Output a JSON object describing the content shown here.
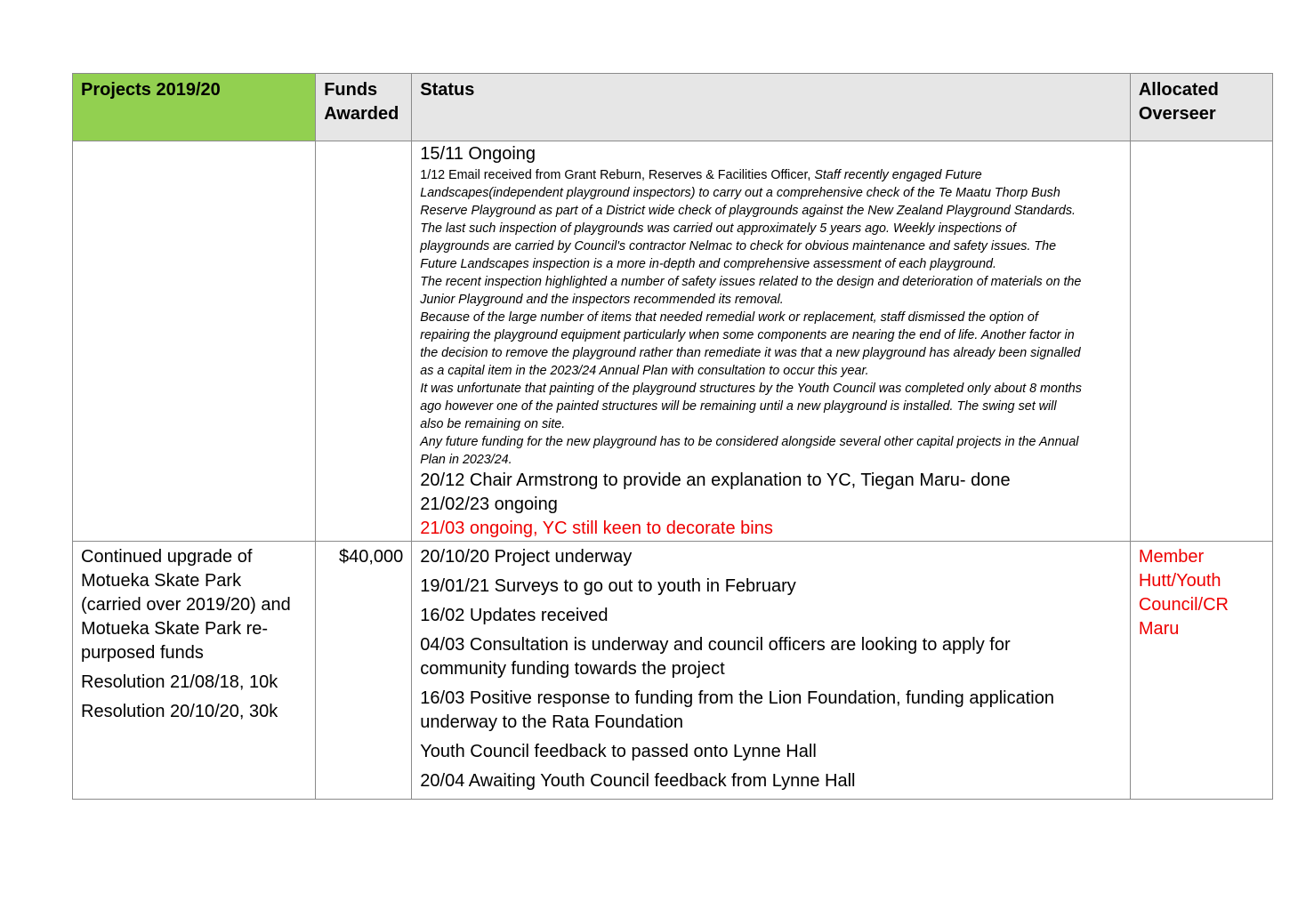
{
  "header": {
    "projects": "Projects 2019/20",
    "funds": "Funds Awarded",
    "status": "Status",
    "overseer": "Allocated Overseer"
  },
  "row1": {
    "status_first": "15/11 Ongoing",
    "email_intro": "1/12 Email received from Grant Reburn, Reserves & Facilities Officer, ",
    "email_lines": [
      "Staff recently engaged Future",
      "Landscapes(independent playground inspectors) to carry out a comprehensive check of the Te Maatu Thorp Bush",
      "Reserve Playground as part of a District wide check of playgrounds against the New Zealand Playground Standards.",
      "The last such inspection of playgrounds was carried out approximately 5 years ago.  Weekly inspections of",
      "playgrounds are carried by Council's contractor Nelmac to check for obvious maintenance and safety issues.  The",
      "Future Landscapes inspection is a more in-depth and comprehensive assessment of each playground.",
      "The recent inspection highlighted a number of safety issues related to the design and deterioration of materials on the",
      "Junior Playground and the inspectors recommended its removal.",
      "Because of the large number of items that needed remedial work or replacement, staff dismissed the option of",
      "repairing the playground equipment particularly when some components are nearing the end of life. Another factor in",
      "the decision to remove the playground rather than remediate it was that a new playground has already been signalled",
      "as a capital item in the 2023/24 Annual Plan with consultation to occur this year.",
      "It was unfortunate that painting of the playground structures by the Youth Council was completed only about 8 months",
      "ago however one of the painted structures will be remaining until a new playground is installed.   The swing set will",
      "also be remaining on site.",
      "Any future funding for the new playground has to be considered alongside several other capital projects in the Annual",
      "Plan in 2023/24."
    ],
    "status_after": [
      "20/12 Chair Armstrong to provide an explanation to YC, Tiegan Maru- done",
      "21/02/23 ongoing"
    ],
    "status_red": "21/03 ongoing, YC still keen to decorate bins"
  },
  "row2": {
    "project_lines": [
      "Continued upgrade of",
      "Motueka Skate Park",
      "(carried over 2019/20) and",
      "Motueka Skate Park re-",
      "purposed funds"
    ],
    "resolutions": [
      "Resolution 21/08/18, 10k",
      "Resolution 20/10/20, 30k"
    ],
    "funds": "$40,000",
    "status": [
      [
        "20/10/20 Project underway"
      ],
      [
        "19/01/21 Surveys to go out to youth in February"
      ],
      [
        "16/02 Updates received"
      ],
      [
        "04/03 Consultation is underway and council officers are looking to apply for",
        "community funding towards the project"
      ],
      [
        "16/03 Positive response to funding from the Lion Foundation, funding application",
        "underway to the Rata Foundation"
      ],
      [
        "Youth Council feedback to passed onto Lynne Hall"
      ],
      [
        "20/04 Awaiting Youth Council feedback from Lynne Hall"
      ]
    ],
    "overseer_lines": [
      "Member",
      "Hutt/Youth",
      "Council/CR",
      "Maru"
    ]
  },
  "colors": {
    "header_green": "#92d050",
    "header_grey": "#e6e6e6",
    "accent_red": "#ee0000",
    "border": "#8a8a8a"
  }
}
